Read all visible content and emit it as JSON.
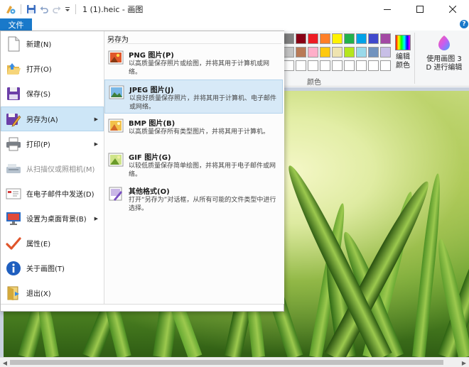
{
  "window": {
    "title": "1 (1).heic - 画图",
    "quick_access_icons": [
      "paint-app-icon",
      "save-icon",
      "undo-icon",
      "redo-icon",
      "customize-dropdown-icon"
    ],
    "controls": [
      "minimize-icon",
      "maximize-icon",
      "close-icon"
    ]
  },
  "menu": {
    "file_tab": "文件",
    "help": "?"
  },
  "ribbon": {
    "colors_group_label": "颜色",
    "edit_colors": {
      "line1": "编辑",
      "line2": "颜色"
    },
    "paint3d": {
      "line1": "使用画图 3",
      "line2": "D 进行编辑"
    },
    "palette_row1": [
      "#7f7f7f",
      "#880015",
      "#ed1c24",
      "#ff7f27",
      "#fff200",
      "#22b14c",
      "#00a2e8",
      "#3f48cc",
      "#a349a4"
    ],
    "palette_row2": [
      "#c3c3c3",
      "#b97a57",
      "#ffaec9",
      "#ffc90e",
      "#efe4b0",
      "#b5e61d",
      "#99d9ea",
      "#7092be",
      "#c8bfe7"
    ],
    "palette_row3": [
      "#ffffff",
      "#ffffff",
      "#ffffff",
      "#ffffff",
      "#ffffff",
      "#ffffff",
      "#ffffff",
      "#ffffff",
      "#ffffff"
    ]
  },
  "file_menu": {
    "items": [
      {
        "label": "新建(N)",
        "icon": "new-document-icon"
      },
      {
        "label": "打开(O)",
        "icon": "open-folder-icon"
      },
      {
        "label": "保存(S)",
        "icon": "save-floppy-icon"
      },
      {
        "label": "另存为(A)",
        "icon": "save-as-icon",
        "submenu": true,
        "active": true
      },
      {
        "label": "打印(P)",
        "icon": "printer-icon",
        "submenu": true
      },
      {
        "label": "从扫描仪或照相机(M)",
        "icon": "scanner-icon",
        "disabled": true
      },
      {
        "label": "在电子邮件中发送(D)",
        "icon": "email-icon"
      },
      {
        "label": "设置为桌面背景(B)",
        "icon": "desktop-background-icon",
        "submenu": true
      },
      {
        "label": "属性(E)",
        "icon": "properties-checkmark-icon"
      },
      {
        "label": "关于画图(T)",
        "icon": "info-icon"
      },
      {
        "label": "退出(X)",
        "icon": "exit-icon"
      }
    ]
  },
  "save_as_submenu": {
    "heading": "另存为",
    "items": [
      {
        "title": "PNG 图片(P)",
        "description": "以高质量保存照片或绘图，并将其用于计算机或网络。",
        "icon": "png-image-icon"
      },
      {
        "title": "JPEG 图片(J)",
        "description": "以良好质量保存照片，并将其用于计算机、电子邮件或网络。",
        "icon": "jpeg-image-icon",
        "active": true
      },
      {
        "title": "BMP 图片(B)",
        "description": "以高质量保存所有类型图片，并将其用于计算机。",
        "icon": "bmp-image-icon"
      },
      {
        "title": "GIF 图片(G)",
        "description": "以较低质量保存简单绘图，并将其用于电子邮件或网络。",
        "icon": "gif-image-icon"
      },
      {
        "title": "其他格式(O)",
        "description": "打开“另存为”对话框，从所有可能的文件类型中进行选择。",
        "icon": "other-formats-icon"
      }
    ]
  }
}
